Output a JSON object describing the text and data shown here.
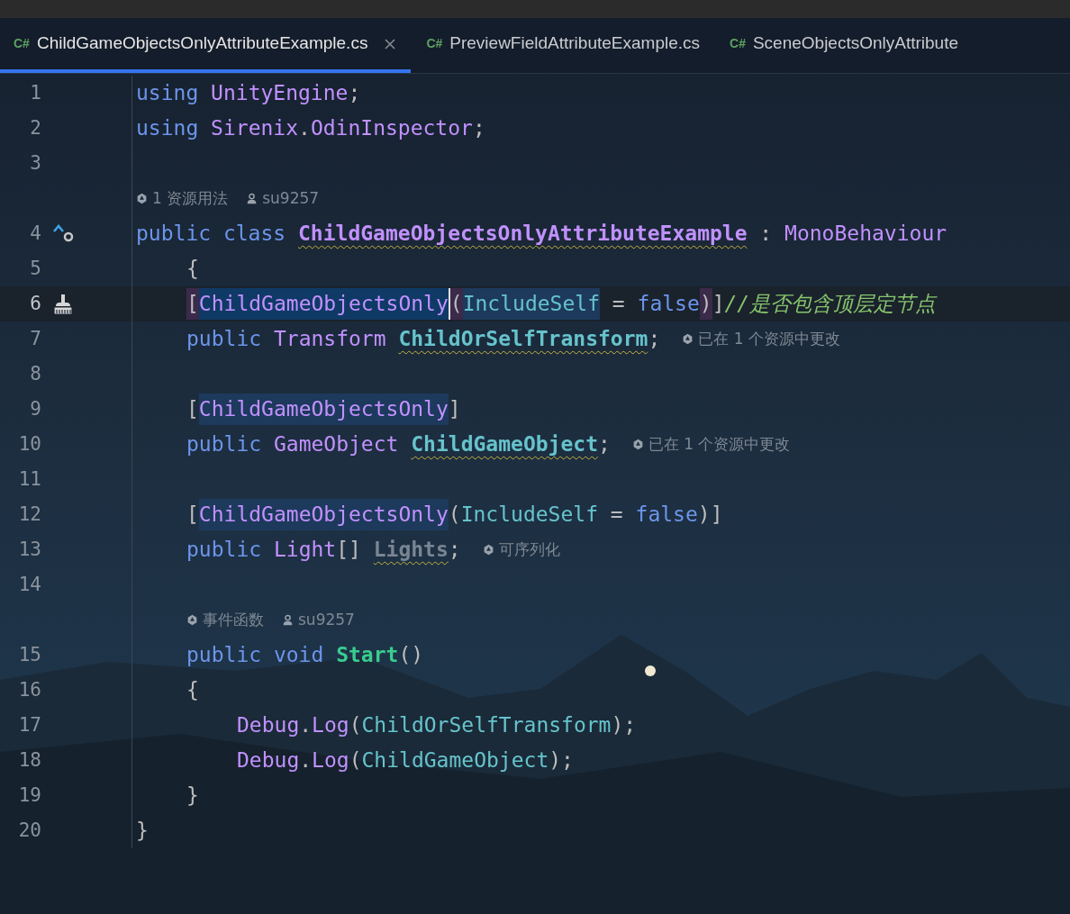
{
  "tabs": [
    {
      "icon": "C#",
      "label": "ChildGameObjectsOnlyAttributeExample.cs",
      "selected": true,
      "closable": true
    },
    {
      "icon": "C#",
      "label": "PreviewFieldAttributeExample.cs",
      "selected": false,
      "closable": false
    },
    {
      "icon": "C#",
      "label": "SceneObjectsOnlyAttribute",
      "selected": false,
      "closable": false
    }
  ],
  "lines": [
    {
      "kind": "code",
      "number": "1",
      "current": false,
      "tokens": [
        {
          "text": "using ",
          "kind": "keyword"
        },
        {
          "text": "UnityEngine",
          "kind": "class"
        },
        {
          "text": ";",
          "kind": "punct"
        }
      ]
    },
    {
      "kind": "code",
      "number": "2",
      "current": false,
      "tokens": [
        {
          "text": "using ",
          "kind": "keyword"
        },
        {
          "text": "Sirenix",
          "kind": "class"
        },
        {
          "text": ".",
          "kind": "punct"
        },
        {
          "text": "OdinInspector",
          "kind": "class"
        },
        {
          "text": ";",
          "kind": "punct"
        }
      ]
    },
    {
      "kind": "code",
      "number": "3",
      "current": false
    },
    {
      "kind": "hint",
      "items": [
        {
          "kind": "unity",
          "text": "1 资源用法"
        },
        {
          "kind": "author",
          "text": "su9257"
        }
      ]
    },
    {
      "kind": "code",
      "number": "4",
      "current": false,
      "gutter": {
        "kind": "inherits"
      },
      "tokens": [
        {
          "text": "public class ",
          "kind": "keyword"
        },
        {
          "text": "ChildGameObjectsOnlyAttributeExample",
          "kind": "classdecl",
          "warning": true
        },
        {
          "text": " : ",
          "kind": "punct"
        },
        {
          "text": "MonoBehaviour",
          "kind": "class"
        }
      ],
      "children": [
        {
          "kind": "code",
          "number": "5",
          "current": false,
          "tokens": [
            {
              "text": "{",
              "kind": "punct"
            }
          ]
        },
        {
          "kind": "code",
          "number": "6",
          "current": true,
          "gutter": {
            "kind": "cleanup"
          },
          "tokens": [
            {
              "text": "[",
              "kind": "punct",
              "matched": true
            },
            {
              "text": "ChildGameObjectsOnly",
              "kind": "class",
              "selected": true,
              "caret": true
            },
            {
              "text": "(",
              "kind": "punct",
              "matched": true
            },
            {
              "text": "IncludeSelf",
              "kind": "field",
              "usage": true
            },
            {
              "text": " = ",
              "kind": "punct"
            },
            {
              "text": "false",
              "kind": "keyword"
            },
            {
              "text": ")",
              "kind": "punct",
              "matched": true
            },
            {
              "text": "]",
              "kind": "punct"
            },
            {
              "text": "//是否包含顶层定节点",
              "kind": "comment"
            }
          ]
        },
        {
          "kind": "code",
          "number": "7",
          "current": false,
          "tokens": [
            {
              "text": "public ",
              "kind": "keyword"
            },
            {
              "text": "Transform ",
              "kind": "class"
            },
            {
              "text": "ChildOrSelfTransform",
              "kind": "fielddecl",
              "warning": true
            },
            {
              "text": ";",
              "kind": "punct"
            }
          ],
          "hint": {
            "kind": "unity",
            "text": "已在 1 个资源中更改"
          }
        },
        {
          "kind": "code",
          "number": "8",
          "current": false
        },
        {
          "kind": "code",
          "number": "9",
          "current": false,
          "tokens": [
            {
              "text": "[",
              "kind": "punct"
            },
            {
              "text": "ChildGameObjectsOnly",
              "kind": "class",
              "usage": true
            },
            {
              "text": "]",
              "kind": "punct"
            }
          ]
        },
        {
          "kind": "code",
          "number": "10",
          "current": false,
          "tokens": [
            {
              "text": "public ",
              "kind": "keyword"
            },
            {
              "text": "GameObject ",
              "kind": "class"
            },
            {
              "text": "ChildGameObject",
              "kind": "fielddecl",
              "warning": true
            },
            {
              "text": ";",
              "kind": "punct"
            }
          ],
          "hint": {
            "kind": "unity",
            "text": "已在 1 个资源中更改"
          }
        },
        {
          "kind": "code",
          "number": "11",
          "current": false
        },
        {
          "kind": "code",
          "number": "12",
          "current": false,
          "tokens": [
            {
              "text": "[",
              "kind": "punct"
            },
            {
              "text": "ChildGameObjectsOnly",
              "kind": "class",
              "usage": true
            },
            {
              "text": "(",
              "kind": "punct"
            },
            {
              "text": "IncludeSelf",
              "kind": "field"
            },
            {
              "text": " = ",
              "kind": "punct"
            },
            {
              "text": "false",
              "kind": "keyword"
            },
            {
              "text": ")]",
              "kind": "punct"
            }
          ]
        },
        {
          "kind": "code",
          "number": "13",
          "current": false,
          "tokens": [
            {
              "text": "public ",
              "kind": "keyword"
            },
            {
              "text": "Light",
              "kind": "class"
            },
            {
              "text": "[] ",
              "kind": "punct"
            },
            {
              "text": "Lights",
              "kind": "unused",
              "warning": true
            },
            {
              "text": ";",
              "kind": "punct"
            }
          ],
          "hint": {
            "kind": "unity",
            "text": "可序列化"
          }
        },
        {
          "kind": "code",
          "number": "14",
          "current": false
        },
        {
          "kind": "hint",
          "items": [
            {
              "kind": "unity",
              "text": "事件函数"
            },
            {
              "kind": "author",
              "text": "su9257"
            }
          ]
        },
        {
          "kind": "code",
          "number": "15",
          "current": false,
          "tokens": [
            {
              "text": "public void ",
              "kind": "keyword"
            },
            {
              "text": "Start",
              "kind": "method"
            },
            {
              "text": "()",
              "kind": "punct"
            }
          ]
        },
        {
          "kind": "code",
          "number": "16",
          "current": false,
          "tokens": [
            {
              "text": "{",
              "kind": "punct"
            }
          ],
          "children": [
            {
              "kind": "code",
              "number": "17",
              "current": false,
              "tokens": [
                {
                  "text": "Debug",
                  "kind": "class"
                },
                {
                  "text": ".",
                  "kind": "punct"
                },
                {
                  "text": "Log",
                  "kind": "class"
                },
                {
                  "text": "(",
                  "kind": "punct"
                },
                {
                  "text": "ChildOrSelfTransform",
                  "kind": "field"
                },
                {
                  "text": ");",
                  "kind": "punct"
                }
              ]
            },
            {
              "kind": "code",
              "number": "18",
              "current": false,
              "tokens": [
                {
                  "text": "Debug",
                  "kind": "class"
                },
                {
                  "text": ".",
                  "kind": "punct"
                },
                {
                  "text": "Log",
                  "kind": "class"
                },
                {
                  "text": "(",
                  "kind": "punct"
                },
                {
                  "text": "ChildGameObject",
                  "kind": "field"
                },
                {
                  "text": ");",
                  "kind": "punct"
                }
              ]
            }
          ]
        },
        {
          "kind": "code",
          "number": "19",
          "current": false,
          "tokens": [
            {
              "text": "}",
              "kind": "punct"
            }
          ]
        }
      ]
    },
    {
      "kind": "code",
      "number": "20",
      "current": false,
      "tokens": [
        {
          "text": "}",
          "kind": "punct"
        }
      ]
    }
  ]
}
